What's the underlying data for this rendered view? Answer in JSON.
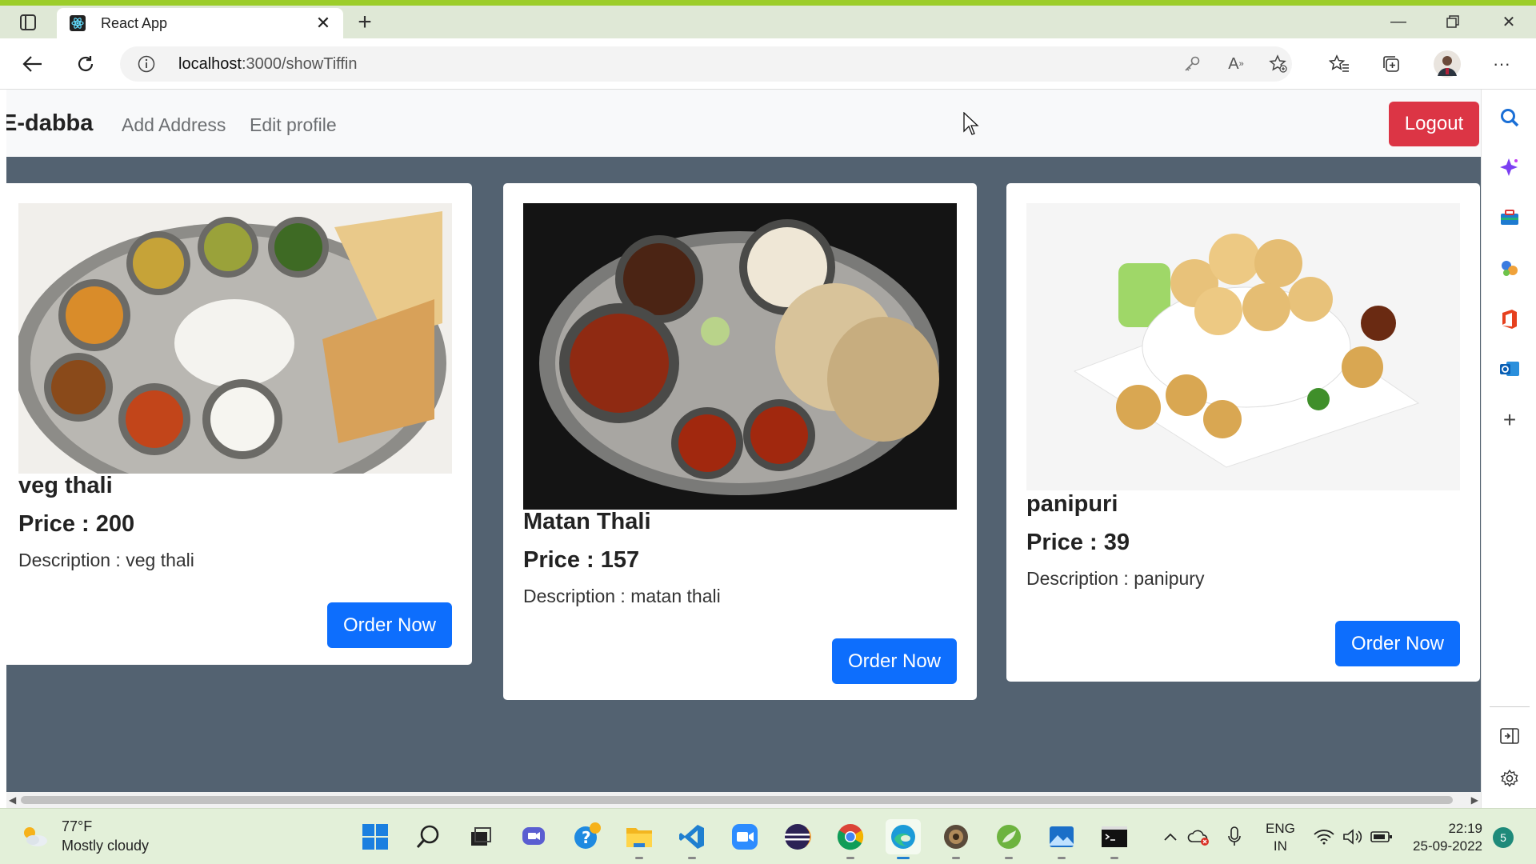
{
  "browser": {
    "tab_title": "React App",
    "url_host": "localhost",
    "url_path": ":3000/showTiffin"
  },
  "navbar": {
    "brand": "E-dabba",
    "links": [
      "Add Address",
      "Edit profile"
    ],
    "logout_label": "Logout"
  },
  "cards": [
    {
      "name": "veg thali",
      "price": "Price : 200",
      "description": "Description : veg thali",
      "button": "Order Now"
    },
    {
      "name": "Matan Thali",
      "price": "Price : 157",
      "description": "Description : matan thali",
      "button": "Order Now"
    },
    {
      "name": "panipuri",
      "price": "Price : 39",
      "description": "Description : panipury",
      "button": "Order Now"
    }
  ],
  "taskbar": {
    "weather_temp": "77°F",
    "weather_cond": "Mostly cloudy",
    "lang_1": "ENG",
    "lang_2": "IN",
    "time": "22:19",
    "date": "25-09-2022",
    "notifications": "5"
  },
  "colors": {
    "page_bg": "#536271",
    "logout": "#dc3545",
    "primary": "#0d6efd"
  }
}
